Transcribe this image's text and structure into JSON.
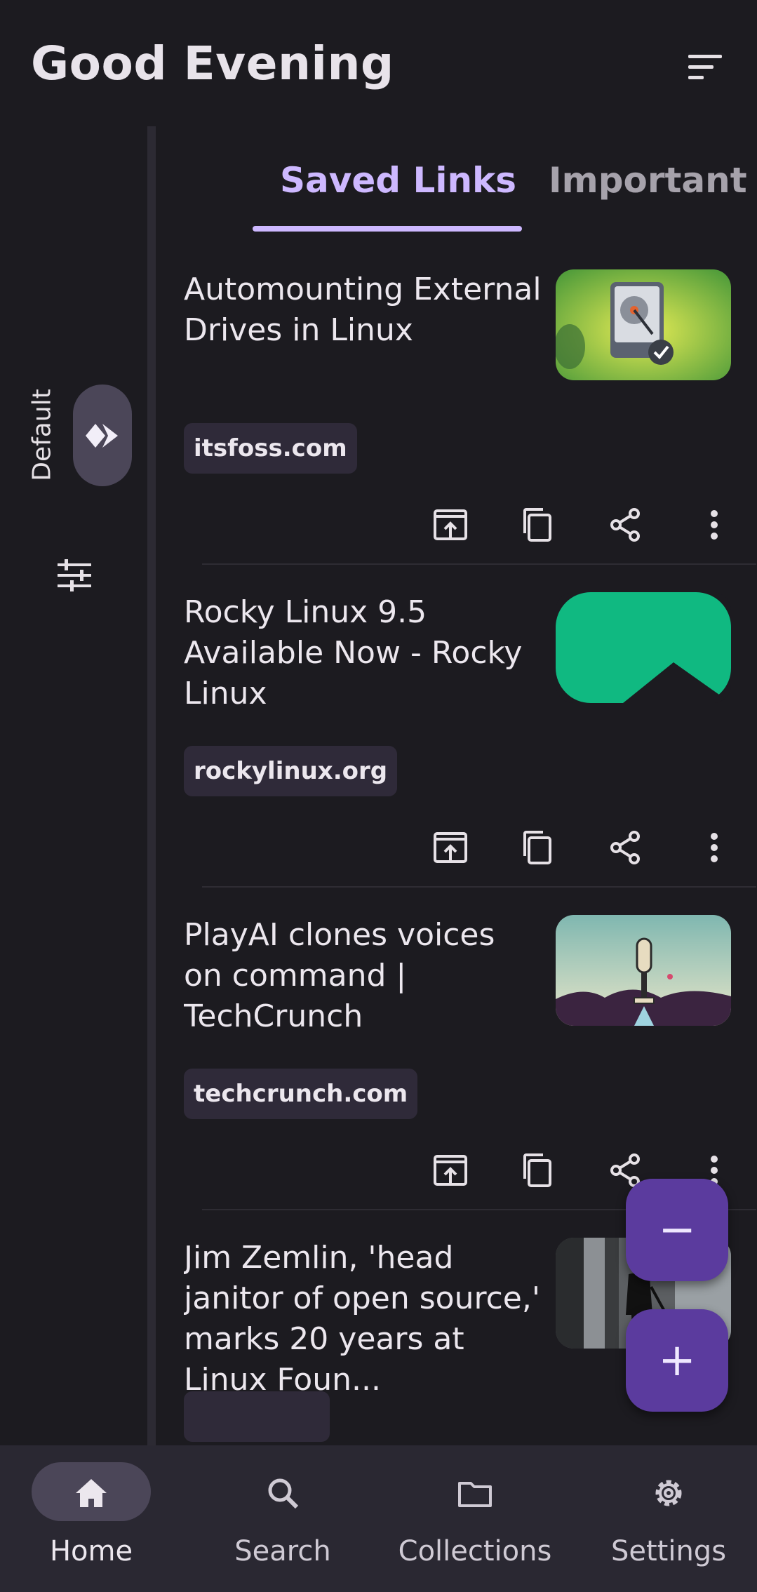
{
  "header": {
    "greeting": "Good Evening"
  },
  "rail": {
    "collection_label": "Default"
  },
  "tabs": [
    {
      "label": "Saved Links",
      "active": true
    },
    {
      "label": "Important Links",
      "active": false
    }
  ],
  "links": [
    {
      "title": "Automounting External Drives in Linux",
      "domain": "itsfoss.com",
      "thumb": "hard-drive-image"
    },
    {
      "title": "Rocky Linux 9.5 Available Now - Rocky Linux",
      "domain": "rockylinux.org",
      "thumb": "rocky-linux-logo-image"
    },
    {
      "title": "PlayAI clones voices on command | TechCrunch",
      "domain": "techcrunch.com",
      "thumb": "microphone-illustration-image"
    },
    {
      "title": "Jim Zemlin, 'head janitor of open source,' marks 20 years at Linux Foun...",
      "domain": "",
      "thumb": "janitor-photo-image"
    }
  ],
  "fabs": {
    "minus_label": "−",
    "plus_label": "+"
  },
  "nav": [
    {
      "label": "Home",
      "icon": "home-icon",
      "active": true
    },
    {
      "label": "Search",
      "icon": "search-icon",
      "active": false
    },
    {
      "label": "Collections",
      "icon": "folder-icon",
      "active": false
    },
    {
      "label": "Settings",
      "icon": "gear-icon",
      "active": false
    }
  ],
  "colors": {
    "background": "#1c1b20",
    "accent": "#cdb8ff",
    "fab": "#5b3b9e",
    "nav_bar": "#2a2832",
    "chip": "#2f2a39"
  }
}
